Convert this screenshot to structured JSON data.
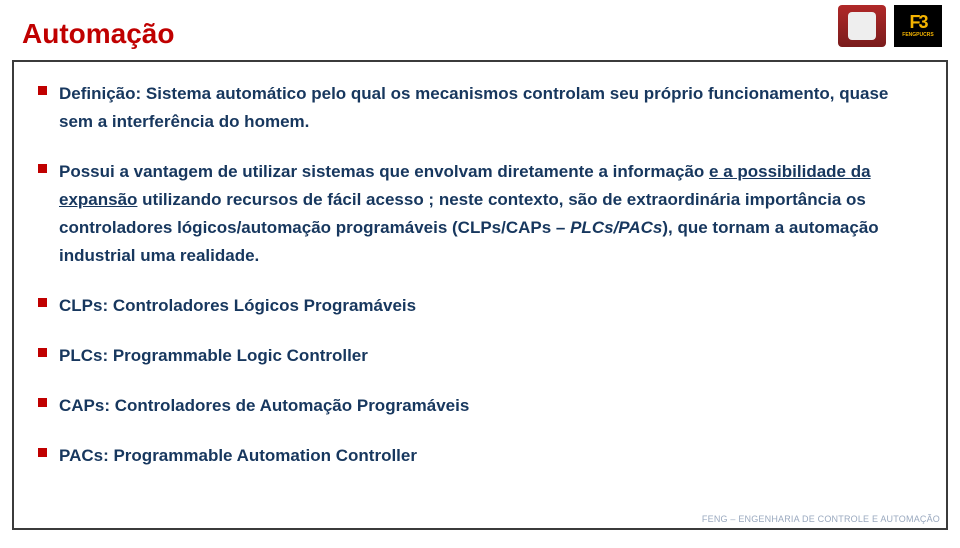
{
  "title": "Automação",
  "logos": {
    "b_line1": "F3",
    "b_line2": "FENGPUCRS"
  },
  "bullets": [
    {
      "parts": [
        {
          "text": "Definição: Sistema automático pelo qual os mecanismos controlam seu próprio funcionamento, quase sem a interferência do homem."
        }
      ]
    },
    {
      "parts": [
        {
          "text": "Possui a vantagem de utilizar sistemas que envolvam diretamente a informação "
        },
        {
          "text": "e a possibilidade da expansão",
          "u": true
        },
        {
          "text": " utilizando recursos de fácil acesso ; neste contexto, são de extraordinária importância os controladores lógicos/automação programáveis (CLPs/CAPs – "
        },
        {
          "text": "PLCs/PACs",
          "i": true
        },
        {
          "text": "), que tornam a automação industrial uma realidade."
        }
      ]
    },
    {
      "parts": [
        {
          "text": "CLPs: Controladores Lógicos Programáveis"
        }
      ]
    },
    {
      "parts": [
        {
          "text": "PLCs: Programmable Logic Controller"
        }
      ]
    },
    {
      "parts": [
        {
          "text": "CAPs: Controladores de Automação Programáveis"
        }
      ]
    },
    {
      "parts": [
        {
          "text": "PACs: Programmable Automation Controller"
        }
      ]
    }
  ],
  "footer": "FENG – ENGENHARIA DE CONTROLE E AUTOMAÇÃO"
}
